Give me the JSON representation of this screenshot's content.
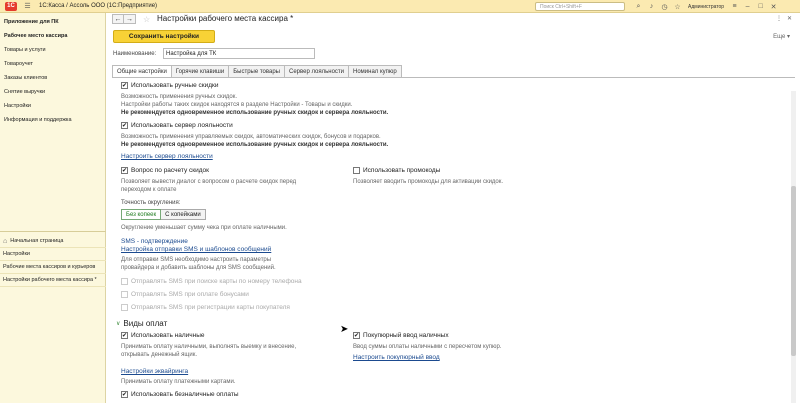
{
  "app": {
    "title": "1С:Касса / Ассоль ООО  (1С:Предприятие)",
    "search_placeholder": "Поиск Ctrl+Shift+F",
    "user": "Администратор",
    "logo_text": "1С"
  },
  "sidebar": {
    "items": [
      {
        "label": "Приложение для ПК",
        "bold": true
      },
      {
        "label": "Рабочее место кассира",
        "bold": true
      },
      {
        "label": "Товары и услуги"
      },
      {
        "label": "Товароучет"
      },
      {
        "label": "Заказы клиентов"
      },
      {
        "label": "Снятие выручки"
      },
      {
        "label": "Настройки"
      },
      {
        "label": "Информация и поддержка"
      }
    ],
    "open_windows": [
      {
        "label": "Начальная страница"
      },
      {
        "label": "Настройки"
      },
      {
        "label": "Рабочие места кассиров и курьеров"
      },
      {
        "label": "Настройки рабочего места кассира *"
      }
    ]
  },
  "form": {
    "title": "Настройки рабочего места кассира *",
    "save_label": "Сохранить настройки",
    "more_label": "Еще",
    "name_label": "Наименование:",
    "name_value": "Настройка для ТК",
    "tabs": [
      {
        "label": "Общие настройки",
        "active": true
      },
      {
        "label": "Горячие клавиши"
      },
      {
        "label": "Быстрые товары"
      },
      {
        "label": "Сервер лояльности"
      },
      {
        "label": "Номинал купюр"
      }
    ]
  },
  "settings": {
    "manual_discounts": {
      "label": "Использовать ручные скидки",
      "checked": true,
      "hint1": "Возможность применения ручных скидок.",
      "hint2": "Настройки работы таких скидок находятся в разделе Настройки - Товары и скидки.",
      "warning": "Не рекомендуется одновременное использование ручных скидок и сервера лояльности."
    },
    "loyalty_server": {
      "label": "Использовать сервер лояльности",
      "checked": true,
      "hint1": "Возможность применения управляемых скидок, автоматических скидок, бонусов и подарков.",
      "warning": "Не рекомендуется одновременное использование ручных скидок и сервера лояльности.",
      "link": "Настроить сервер лояльности"
    },
    "discount_question": {
      "label": "Вопрос по расчету скидок",
      "checked": true,
      "hint1": "Позволяет вывести диалог с вопросом о расчете скидок перед",
      "hint2": "переходом к оплате"
    },
    "promocodes": {
      "label": "Использовать промокоды",
      "checked": false,
      "hint": "Позволяет вводить промокоды для активации скидок."
    },
    "rounding": {
      "label": "Точность округления:",
      "options": [
        "Без копеек",
        "С копейками"
      ],
      "selected": "Без копеек",
      "hint": "Округление уменьшает сумму чека при оплате наличными."
    },
    "sms": {
      "title": "SMS - подтверждение",
      "link": "Настройка отправки SMS и шаблонов сообщений",
      "hint1": "Для отправки SMS необходимо настроить параметры",
      "hint2": "провайдера и добавить шаблоны для SMS сообщений.",
      "options": [
        "Отправлять SMS при поиске карты по номеру телефона",
        "Отправлять SMS при оплате бонусами",
        "Отправлять SMS при регистрации карты покупателя"
      ]
    }
  },
  "payment_types": {
    "title": "Виды оплат",
    "cash": {
      "label": "Использовать наличные",
      "checked": true,
      "hint1": "Принимать оплату наличными, выполнять выемку и внесение,",
      "hint2": "открывать денежный ящик."
    },
    "cash_breakdown": {
      "label": "Покупюрный ввод наличных",
      "checked": true,
      "hint": "Ввод суммы оплаты наличными с пересчетом купюр.",
      "link": "Настроить покупюрный ввод"
    },
    "acquiring": {
      "link": "Настройки эквайринга",
      "hint": "Принимать оплату платежными картами."
    },
    "cashless": {
      "label": "Использовать безналичные оплаты",
      "checked": true
    }
  },
  "colors": {
    "accent_yellow": "#f8d236",
    "sidebar_bg": "#fcf8dd",
    "link_blue": "#1b4a8f",
    "rounding_active": "#1d7a1d"
  }
}
